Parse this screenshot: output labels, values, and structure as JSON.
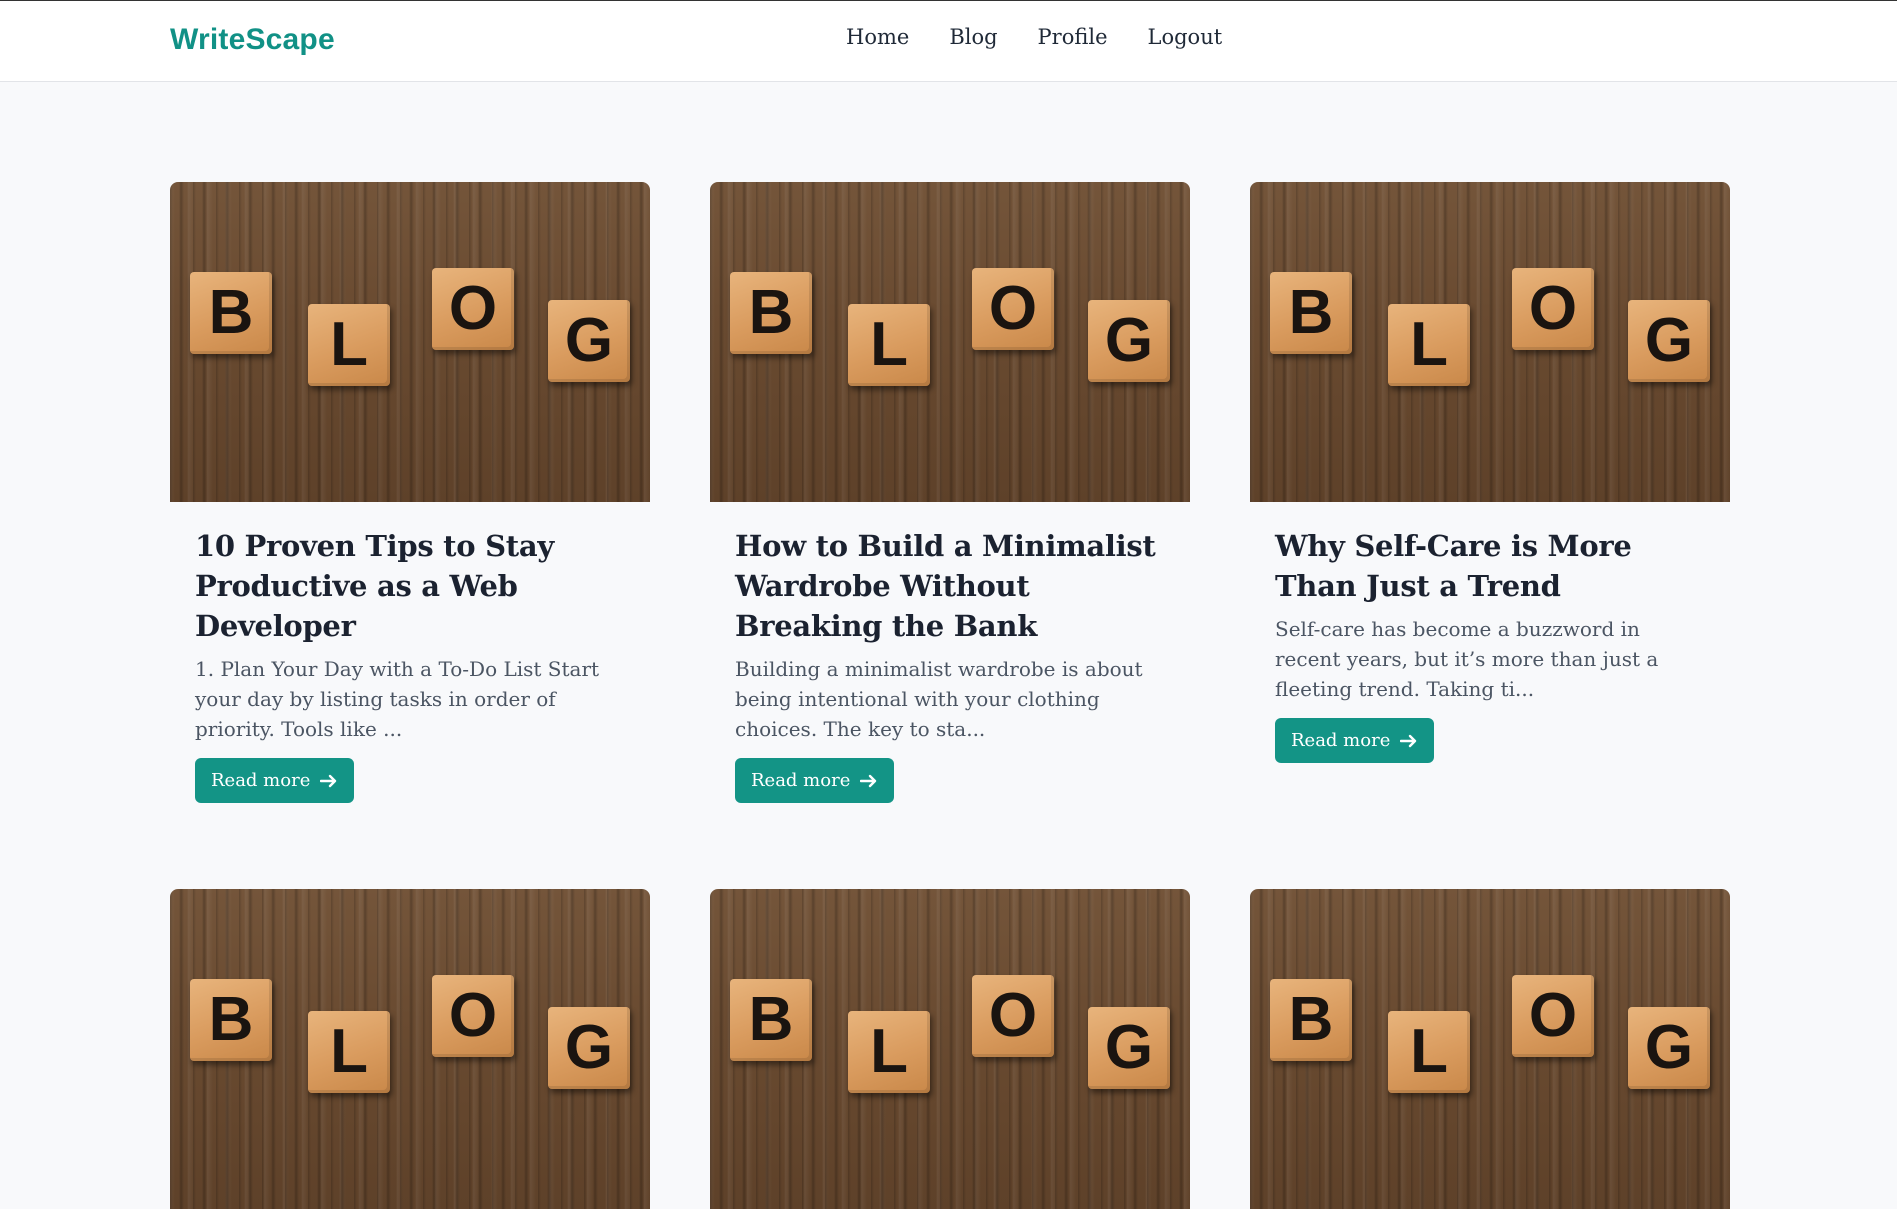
{
  "brand": "WriteScape",
  "nav": [
    {
      "label": "Home"
    },
    {
      "label": "Blog"
    },
    {
      "label": "Profile"
    },
    {
      "label": "Logout"
    }
  ],
  "posts": [
    {
      "image_letters": [
        "B",
        "L",
        "O",
        "G"
      ],
      "title": "10 Proven Tips to Stay Productive as a Web Developer",
      "excerpt": "1. Plan Your Day with a To-Do List Start your day by listing tasks in order of priority. Tools like ...",
      "button_label": "Read more"
    },
    {
      "image_letters": [
        "B",
        "L",
        "O",
        "G"
      ],
      "title": "How to Build a Minimalist Wardrobe Without Breaking the Bank",
      "excerpt": "Building a minimalist wardrobe is about being intentional with your clothing choices. The key to sta...",
      "button_label": "Read more"
    },
    {
      "image_letters": [
        "B",
        "L",
        "O",
        "G"
      ],
      "title": "Why Self-Care is More Than Just a Trend",
      "excerpt": "Self-care has become a buzzword in recent years, but it’s more than just a fleeting trend. Taking ti...",
      "button_label": "Read more"
    },
    {
      "image_letters": [
        "B",
        "L",
        "O",
        "G"
      ],
      "title": "",
      "excerpt": "",
      "button_label": ""
    },
    {
      "image_letters": [
        "B",
        "L",
        "O",
        "G"
      ],
      "title": "",
      "excerpt": "",
      "button_label": ""
    },
    {
      "image_letters": [
        "B",
        "L",
        "O",
        "G"
      ],
      "title": "",
      "excerpt": "",
      "button_label": ""
    }
  ],
  "icons": {
    "read_more": "arrow-right-icon"
  },
  "colors": {
    "accent": "#119186",
    "button": "#139486",
    "background": "#f8f9fb"
  }
}
